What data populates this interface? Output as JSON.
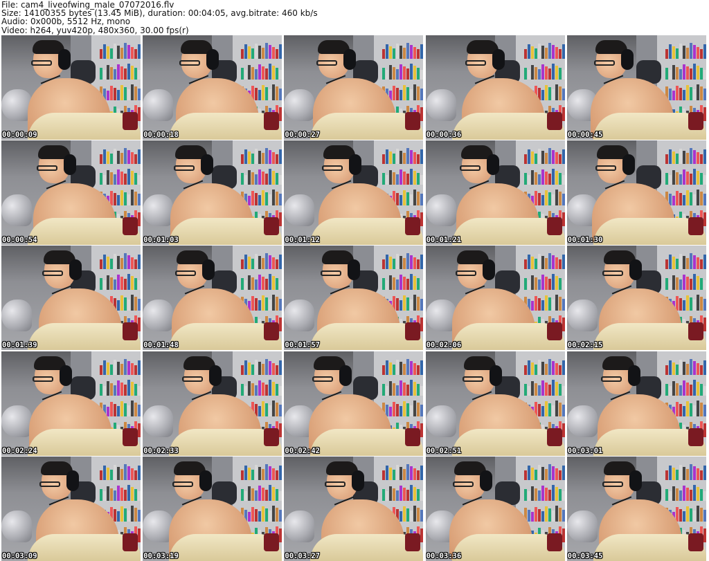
{
  "header": {
    "file_line": "File: cam4_liveofwing_male_07072016.flv",
    "size_line": "Size: 14100355 bytes (13.45 MiB), duration: 00:04:05, avg.bitrate: 460 kb/s",
    "audio_line": "Audio: 0x000b, 5512 Hz, mono",
    "video_line": "Video: h264, yuv420p, 480x360, 30.00 fps(r)"
  },
  "thumbnails": [
    "00:00:09",
    "00:00:18",
    "00:00:27",
    "00:00:36",
    "00:00:45",
    "00:00:54",
    "00:01:03",
    "00:01:12",
    "00:01:21",
    "00:01:30",
    "00:01:39",
    "00:01:48",
    "00:01:57",
    "00:02:06",
    "00:02:15",
    "00:02:24",
    "00:02:33",
    "00:02:42",
    "00:02:51",
    "00:03:01",
    "00:03:09",
    "00:03:19",
    "00:03:27",
    "00:03:36",
    "00:03:45"
  ]
}
